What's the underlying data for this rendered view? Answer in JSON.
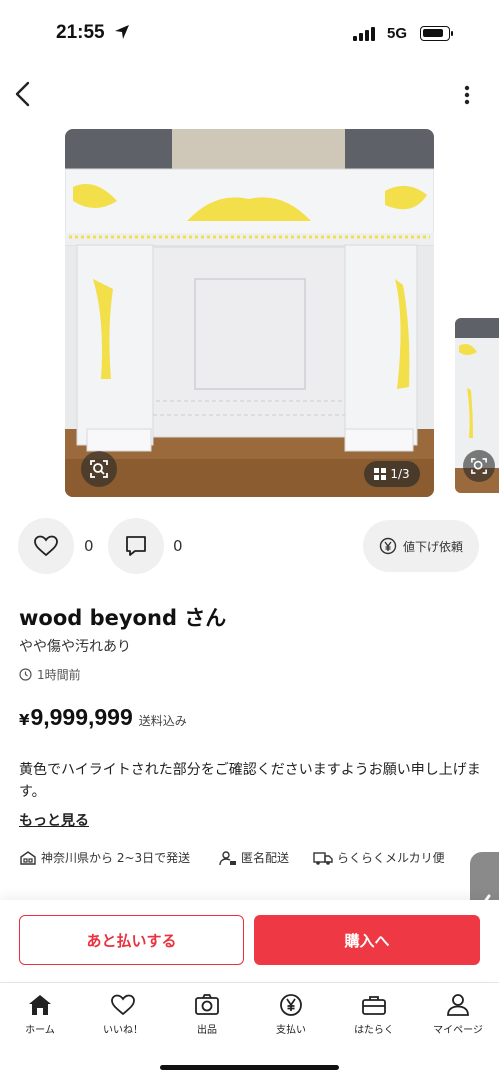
{
  "status_bar": {
    "time": "21:55",
    "network": "5G"
  },
  "photo": {
    "counter": "1/3"
  },
  "actions": {
    "likes": "0",
    "comments": "0",
    "price_request": "値下げ依頼"
  },
  "item": {
    "seller": "wood beyond さん",
    "condition": "やや傷や汚れあり",
    "posted": "1時間前",
    "currency": "¥",
    "price": "9,999,999",
    "shipping_fee": "送料込み",
    "description": "黄色でハイライトされた部分をご確認くださいますようお願い申し上げます。",
    "see_more": "もっと見る"
  },
  "shipping": {
    "origin": "神奈川県から 2~3日で発送",
    "anonymous": "匿名配送",
    "method": "らくらくメルカリ便"
  },
  "buttons": {
    "pay_later": "あと払いする",
    "buy": "購入へ"
  },
  "tabs": [
    {
      "label": "ホーム",
      "icon": "home-icon"
    },
    {
      "label": "いいね！",
      "icon": "heart-icon"
    },
    {
      "label": "出品",
      "icon": "camera-icon"
    },
    {
      "label": "支払い",
      "icon": "yen-icon"
    },
    {
      "label": "はたらく",
      "icon": "briefcase-icon"
    },
    {
      "label": "マイページ",
      "icon": "person-icon"
    }
  ],
  "colors": {
    "accent": "#ee3944",
    "highlight": "#f2df4a"
  }
}
